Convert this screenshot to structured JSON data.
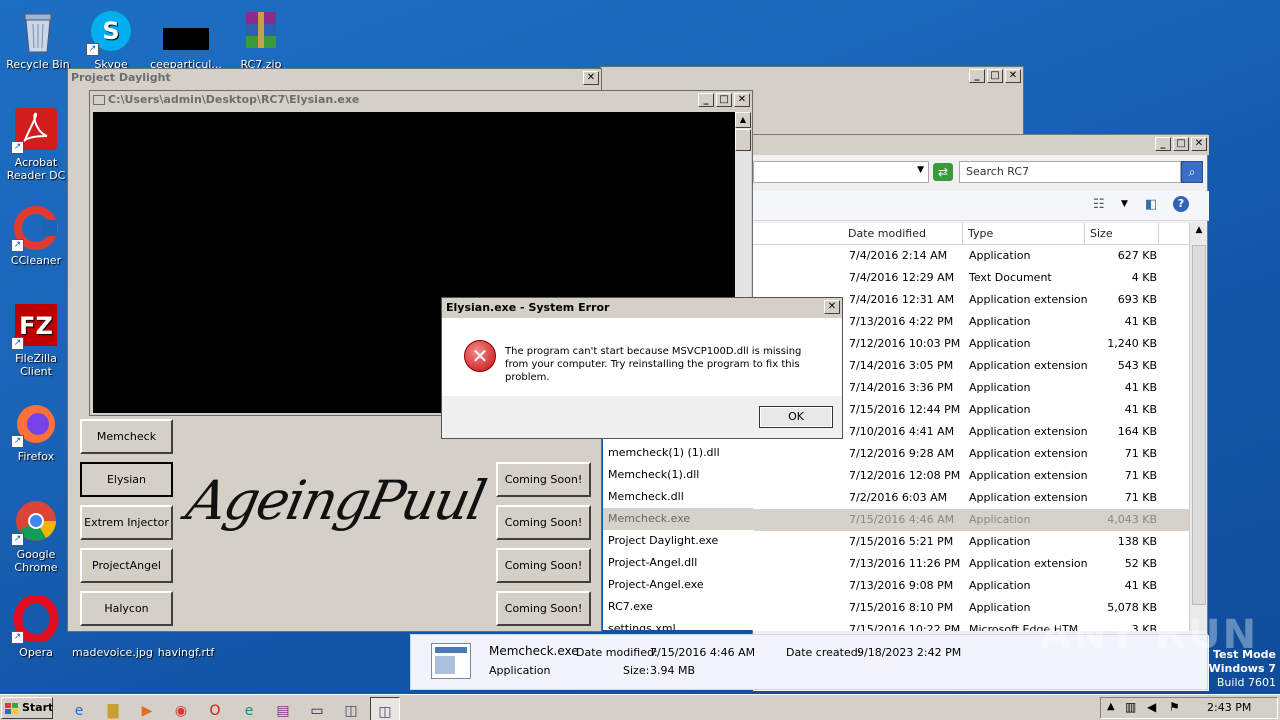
{
  "desktop": {
    "icons": [
      {
        "label": "Recycle Bin"
      },
      {
        "label": "Skype"
      },
      {
        "label": "ceeparticul..."
      },
      {
        "label": "RC7.zip"
      },
      {
        "label": "Acrobat Reader DC"
      },
      {
        "label": "CCleaner"
      },
      {
        "label": "FileZilla Client"
      },
      {
        "label": "Firefox"
      },
      {
        "label": "Google Chrome"
      },
      {
        "label": "Opera"
      },
      {
        "label": "madevoice.jpg"
      },
      {
        "label": "havingf.rtf"
      }
    ]
  },
  "project_window": {
    "title": "Project Daylight",
    "logo_text": "AgeingPuul",
    "left_buttons": [
      "Memcheck",
      "Elysian",
      "Extrem Injector",
      "ProjectAngel",
      "Halycon"
    ],
    "right_buttons": [
      "Coming Soon!",
      "Coming Soon!",
      "Coming Soon!",
      "Coming Soon!"
    ]
  },
  "console_window": {
    "title": "C:\\Users\\admin\\Desktop\\RC7\\Elysian.exe"
  },
  "error_dialog": {
    "title": "Elysian.exe - System Error",
    "message": "The program can't start because MSVCP100D.dll is missing from your computer. Try reinstalling the program to fix this problem.",
    "ok_label": "OK"
  },
  "explorer": {
    "search_placeholder": "Search RC7",
    "columns": [
      "Date modified",
      "Type",
      "Size"
    ],
    "rows": [
      {
        "name": "",
        "date": "7/4/2016 2:14 AM",
        "type": "Application",
        "size": "627 KB"
      },
      {
        "name": "",
        "date": "7/4/2016 12:29 AM",
        "type": "Text Document",
        "size": "4 KB"
      },
      {
        "name": "",
        "date": "7/4/2016 12:31 AM",
        "type": "Application extension",
        "size": "693 KB"
      },
      {
        "name": "",
        "date": "7/13/2016 4:22 PM",
        "type": "Application",
        "size": "41 KB"
      },
      {
        "name": "",
        "date": "7/12/2016 10:03 PM",
        "type": "Application",
        "size": "1,240 KB"
      },
      {
        "name": "",
        "date": "7/14/2016 3:05 PM",
        "type": "Application extension",
        "size": "543 KB"
      },
      {
        "name": "",
        "date": "7/14/2016 3:36 PM",
        "type": "Application",
        "size": "41 KB"
      },
      {
        "name": "",
        "date": "7/15/2016 12:44 PM",
        "type": "Application",
        "size": "41 KB"
      },
      {
        "name": "",
        "date": "7/10/2016 4:41 AM",
        "type": "Application extension",
        "size": "164 KB"
      },
      {
        "name": "memcheck(1) (1).dll",
        "date": "7/12/2016 9:28 AM",
        "type": "Application extension",
        "size": "71 KB"
      },
      {
        "name": "Memcheck(1).dll",
        "date": "7/12/2016 12:08 PM",
        "type": "Application extension",
        "size": "71 KB"
      },
      {
        "name": "Memcheck.dll",
        "date": "7/2/2016 6:03 AM",
        "type": "Application extension",
        "size": "71 KB"
      },
      {
        "name": "Memcheck.exe",
        "date": "7/15/2016 4:46 AM",
        "type": "Application",
        "size": "4,043 KB",
        "selected": true
      },
      {
        "name": "Project Daylight.exe",
        "date": "7/15/2016 5:21 PM",
        "type": "Application",
        "size": "138 KB"
      },
      {
        "name": "Project-Angel.dll",
        "date": "7/13/2016 11:26 PM",
        "type": "Application extension",
        "size": "52 KB"
      },
      {
        "name": "Project-Angel.exe",
        "date": "7/13/2016 9:08 PM",
        "type": "Application",
        "size": "41 KB"
      },
      {
        "name": "RC7.exe",
        "date": "7/15/2016 8:10 PM",
        "type": "Application",
        "size": "5,078 KB"
      },
      {
        "name": "settings.xml",
        "date": "7/15/2016 10:22 PM",
        "type": "Microsoft Edge HTM...",
        "size": "3 KB"
      }
    ],
    "details": {
      "name": "Memcheck.exe",
      "type": "Application",
      "modified_label": "Date modified:",
      "modified": "7/15/2016 4:46 AM",
      "created_label": "Date created:",
      "created": "9/18/2023 2:42 PM",
      "size_label": "Size:",
      "size": "3.94 MB"
    }
  },
  "taskbar": {
    "start_label": "Start",
    "clock": "2:43 PM"
  },
  "watermark": {
    "line1": "Test Mode",
    "line2": "Windows 7",
    "line3": "Build 7601",
    "brand": "ANY RUN"
  }
}
